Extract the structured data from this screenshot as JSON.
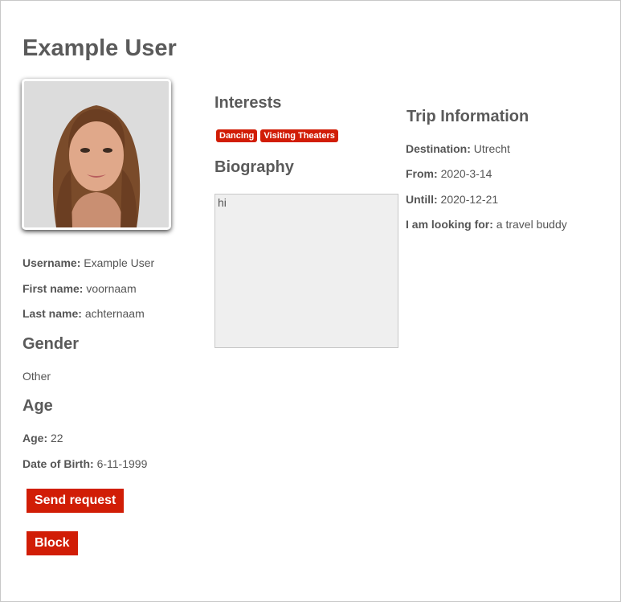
{
  "profile": {
    "title": "Example User",
    "username_label": "Username:",
    "username": "Example User",
    "first_name_label": "First name:",
    "first_name": "voornaam",
    "last_name_label": "Last name:",
    "last_name": "achternaam"
  },
  "gender": {
    "heading": "Gender",
    "value": "Other"
  },
  "age": {
    "heading": "Age",
    "age_label": "Age:",
    "age": "22",
    "dob_label": "Date of Birth:",
    "dob": "6-11-1999"
  },
  "actions": {
    "send_request_label": "Send request",
    "block_label": "Block"
  },
  "interests": {
    "heading": "Interests",
    "tags": [
      "Dancing",
      "Visiting Theaters"
    ]
  },
  "biography": {
    "heading": "Biography",
    "text": "hi"
  },
  "trip": {
    "heading": "Trip Information",
    "destination_label": "Destination:",
    "destination": "Utrecht",
    "from_label": "From:",
    "from": "2020-3-14",
    "until_label": "Untill:",
    "until": "2020-12-21",
    "looking_for_label": "I am looking for:",
    "looking_for": "a travel buddy"
  },
  "colors": {
    "accent": "#d11d06",
    "text": "#555555",
    "heading": "#5a5a5a"
  }
}
